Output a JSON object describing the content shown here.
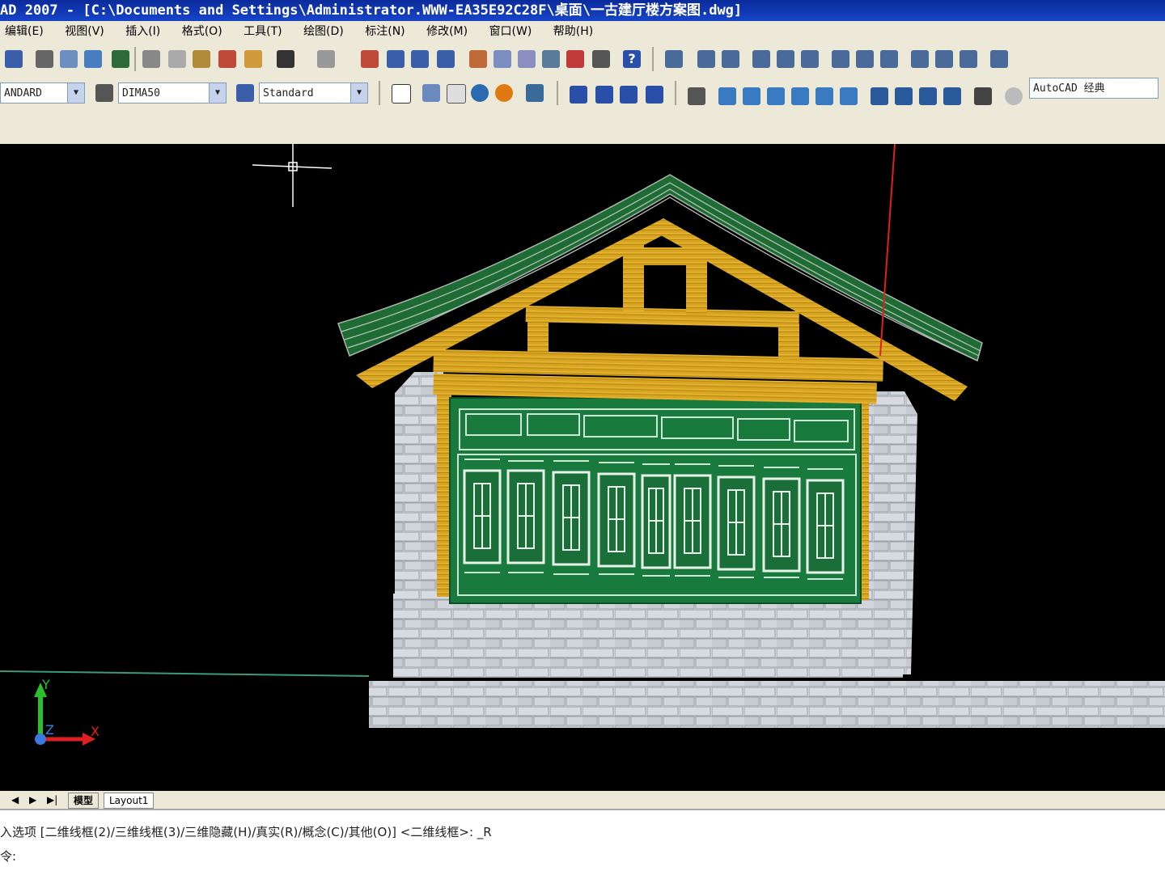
{
  "window": {
    "title": "AD 2007 - [C:\\Documents and Settings\\Administrator.WWW-EA35E92C28F\\桌面\\一古建厅楼方案图.dwg]"
  },
  "menu": [
    "编辑(E)",
    "视图(V)",
    "插入(I)",
    "格式(O)",
    "工具(T)",
    "绘图(D)",
    "标注(N)",
    "修改(M)",
    "窗口(W)",
    "帮助(H)"
  ],
  "toolbar": {
    "text_style": "ANDARD",
    "dim_style": "DIMA50",
    "table_style": "Standard",
    "workspace": "AutoCAD 经典"
  },
  "ucs": {
    "y": "Y",
    "z": "Z",
    "x": "X"
  },
  "layout_tabs": [
    "模型",
    "Layout1"
  ],
  "command": {
    "line1": "入选项 [二维线框(2)/三维线框(3)/三维隐藏(H)/真实(R)/概念(C)/其他(O)] <二维线框>: _R",
    "line2": "令:"
  },
  "colors": {
    "roof": "#1f6b34",
    "beam": "#d9a520",
    "panel": "#1a7a3e",
    "brick": "#c9cdd4"
  }
}
